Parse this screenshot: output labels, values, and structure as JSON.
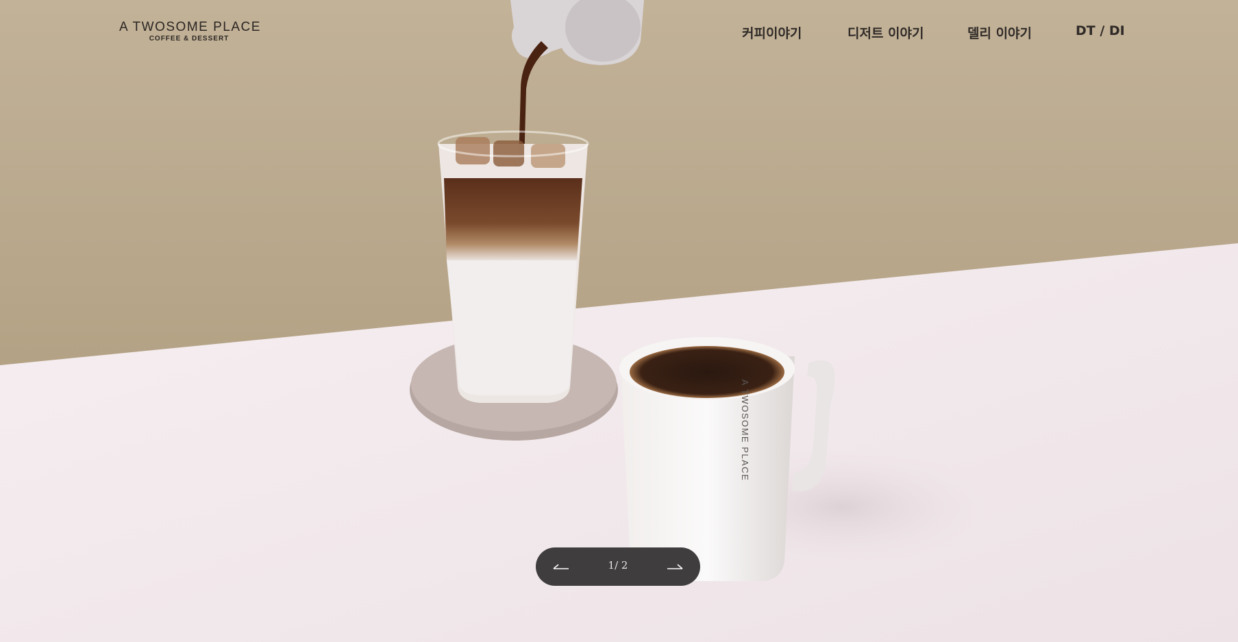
{
  "brand": {
    "name": "A TWOSOME PLACE",
    "tagline": "COFFEE & DESSERT",
    "mug_print": "A TWOSOME PLACE"
  },
  "nav": {
    "items": [
      {
        "label": "커피이야기"
      },
      {
        "label": "디저트 이야기"
      },
      {
        "label": "델리 이야기"
      },
      {
        "label": "DT / DI"
      }
    ]
  },
  "slider": {
    "current": "1",
    "total": "2",
    "separator": "/ ",
    "prev_icon": "arrow-left-icon",
    "next_icon": "arrow-right-icon"
  },
  "colors": {
    "wall": "#b9a88f",
    "table": "#f3eaee",
    "pager_bg": "#3f3d3d",
    "nav_text": "#2f2a27"
  }
}
